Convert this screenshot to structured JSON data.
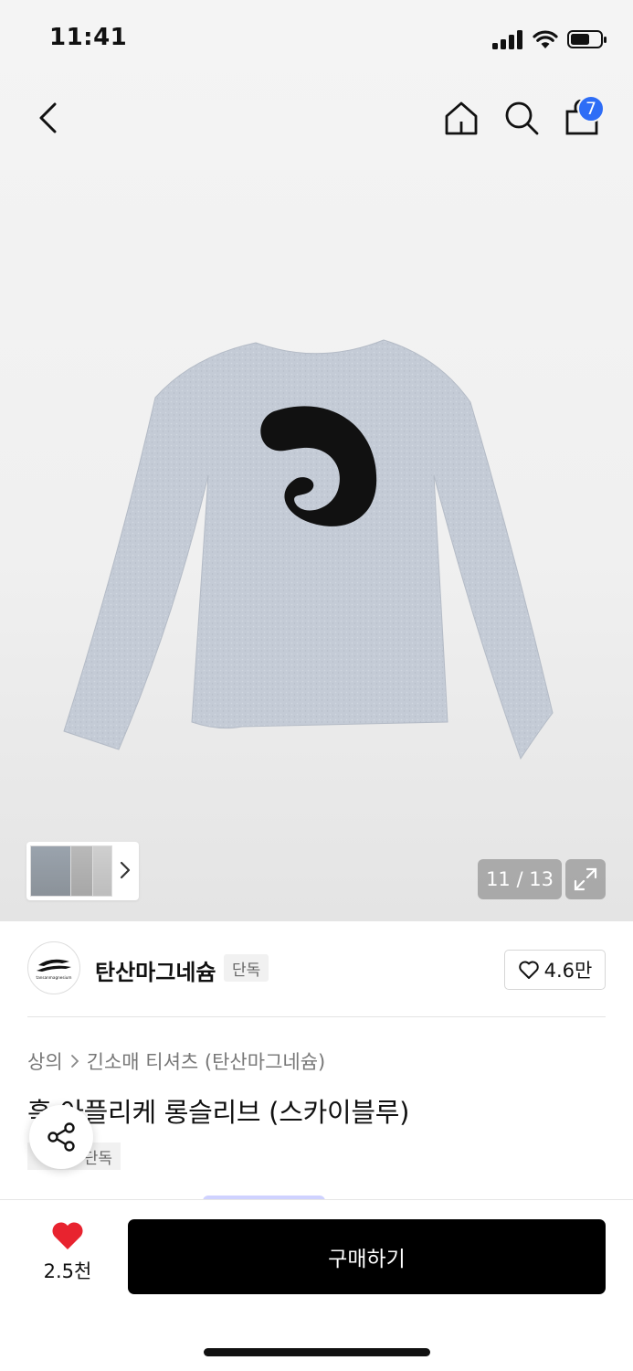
{
  "status_bar": {
    "time": "11:41"
  },
  "nav": {
    "cart_count": "7"
  },
  "gallery": {
    "current_page": "11 / 13",
    "current": 11,
    "total": 13
  },
  "brand": {
    "name": "탄산마그네슘",
    "logo_text": "tansanmagnesium",
    "tag": "단독",
    "likes": "4.6만"
  },
  "product": {
    "breadcrumb": [
      "상의",
      "긴소매 티셔츠 (탄산마그네슘)"
    ],
    "title": "훅 아플리케 롱슬리브 (스카이블루)",
    "tag": "단독"
  },
  "bottom": {
    "wish_count": "2.5천",
    "buy_label": "구매하기"
  },
  "colors": {
    "badge": "#2e6df6",
    "heart": "#e8232f",
    "buy_button": "#000000"
  },
  "icons": [
    "back-icon",
    "home-icon",
    "search-icon",
    "cart-icon",
    "chevron-right-icon",
    "expand-icon",
    "heart-outline-icon",
    "share-icon",
    "heart-filled-icon"
  ]
}
